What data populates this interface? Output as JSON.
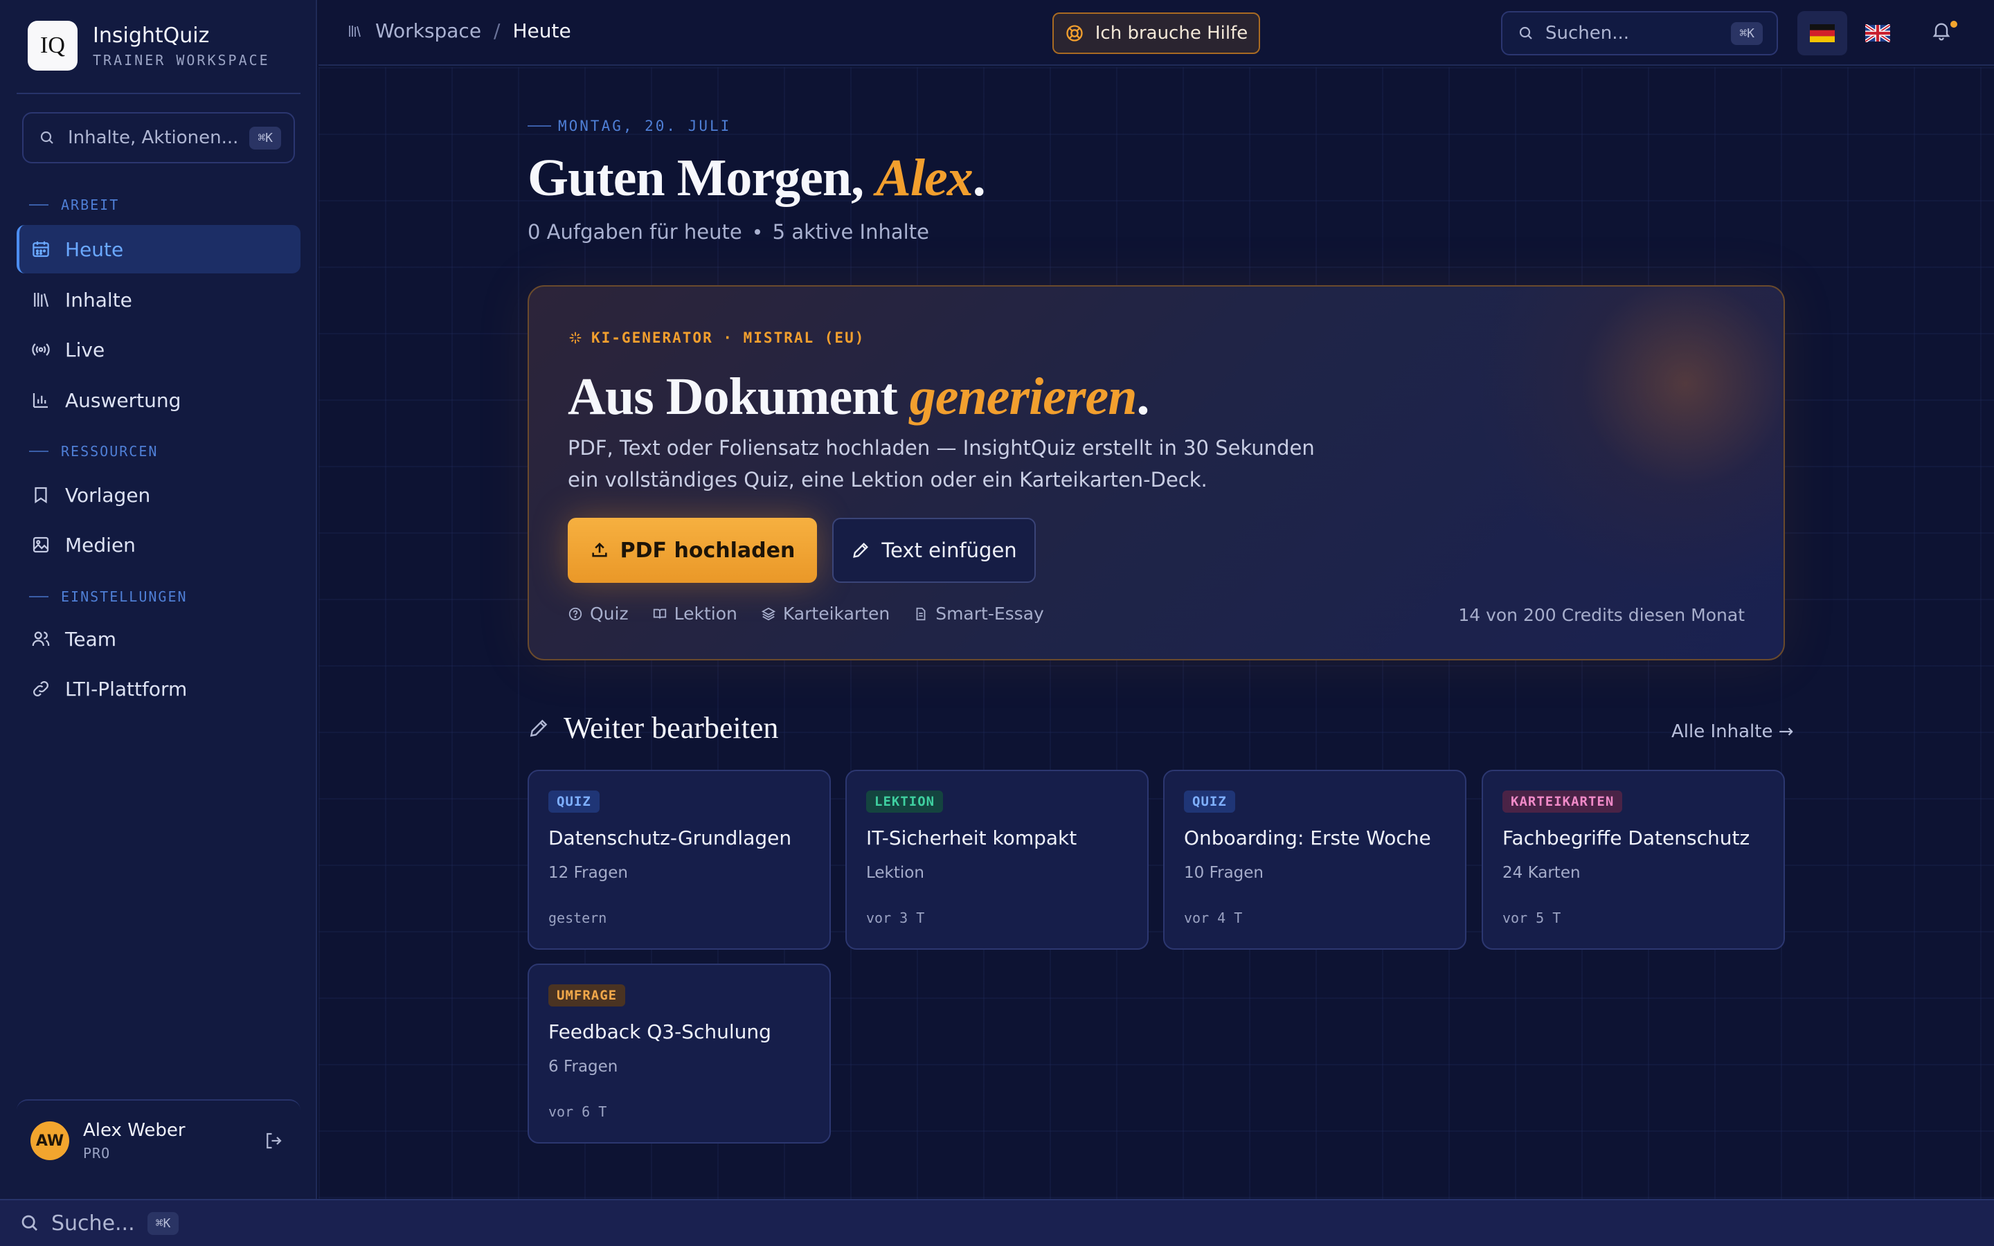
{
  "brand": {
    "logo": "IQ",
    "name": "InsightQuiz",
    "subtitle": "TRAINER WORKSPACE"
  },
  "sidebar": {
    "search_placeholder": "Inhalte, Aktionen...",
    "search_shortcut": "⌘K",
    "sections": [
      {
        "label": "ARBEIT"
      },
      {
        "label": "RESSOURCEN"
      },
      {
        "label": "EINSTELLUNGEN"
      }
    ],
    "items": [
      {
        "label": "Heute",
        "icon": "calendar-icon",
        "active": true
      },
      {
        "label": "Inhalte",
        "icon": "library-icon"
      },
      {
        "label": "Live",
        "icon": "broadcast-icon"
      },
      {
        "label": "Auswertung",
        "icon": "bar-chart-icon"
      },
      {
        "label": "Vorlagen",
        "icon": "bookmark-icon"
      },
      {
        "label": "Medien",
        "icon": "image-icon"
      },
      {
        "label": "Team",
        "icon": "users-icon"
      },
      {
        "label": "LTI-Plattform",
        "icon": "link-icon"
      }
    ],
    "user": {
      "initials": "AW",
      "name": "Alex Weber",
      "plan": "PRO"
    }
  },
  "topbar": {
    "breadcrumb": {
      "root": "Workspace",
      "separator": "/",
      "current": "Heute"
    },
    "help_label": "Ich brauche Hilfe",
    "search_placeholder": "Suchen...",
    "search_shortcut": "⌘K",
    "languages": [
      {
        "flag": "🇩🇪",
        "active": true
      },
      {
        "flag": "🇬🇧",
        "active": false
      }
    ]
  },
  "main": {
    "date_label": "MONTAG, 20. JULI",
    "greeting_prefix": "Guten Morgen, ",
    "greeting_name": "Alex",
    "greeting_suffix": ".",
    "stats": {
      "tasks": "0 Aufgaben für heute",
      "active": "5 aktive Inhalte"
    },
    "generator": {
      "tag": "KI-GENERATOR · MISTRAL (EU)",
      "title_prefix": "Aus Dokument ",
      "title_accent": "generieren",
      "title_suffix": ".",
      "description": "PDF, Text oder Foliensatz hochladen — InsightQuiz erstellt in 30 Sekunden ein vollständiges Quiz, eine Lektion oder ein Karteikarten-Deck.",
      "primary_button": "PDF hochladen",
      "secondary_button": "Text einfügen",
      "types": [
        {
          "label": "Quiz",
          "icon": "help-circle-icon"
        },
        {
          "label": "Lektion",
          "icon": "book-icon"
        },
        {
          "label": "Karteikarten",
          "icon": "layers-icon"
        },
        {
          "label": "Smart-Essay",
          "icon": "document-icon"
        }
      ],
      "credits": "14 von 200 Credits diesen Monat"
    },
    "continue": {
      "title": "Weiter bearbeiten",
      "all_link": "Alle Inhalte →",
      "cards": [
        {
          "badge": "QUIZ",
          "title": "Datenschutz-Grundlagen",
          "meta": "12 Fragen",
          "time": "gestern"
        },
        {
          "badge": "LEKTION",
          "title": "IT-Sicherheit kompakt",
          "meta": "Lektion",
          "time": "vor 3 T"
        },
        {
          "badge": "QUIZ",
          "title": "Onboarding: Erste Woche",
          "meta": "10 Fragen",
          "time": "vor 4 T"
        },
        {
          "badge": "KARTEIKARTEN",
          "title": "Fachbegriffe Datenschutz",
          "meta": "24 Karten",
          "time": "vor 5 T"
        },
        {
          "badge": "UMFRAGE",
          "title": "Feedback Q3-Schulung",
          "meta": "6 Fragen",
          "time": "vor 6 T"
        }
      ]
    }
  },
  "bottom_search": {
    "placeholder": "Suche...",
    "shortcut": "⌘K"
  },
  "colors": {
    "accent": "#f29f2e",
    "primary_blue": "#4c8df0",
    "background": "#0d1333"
  }
}
